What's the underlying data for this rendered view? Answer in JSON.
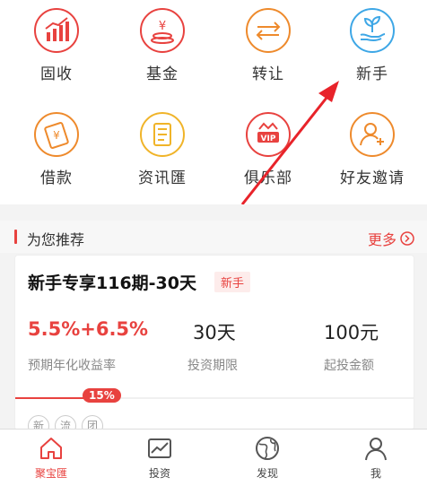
{
  "quick_menu": [
    {
      "label": "固收",
      "icon": "chart-growth-icon"
    },
    {
      "label": "基金",
      "icon": "fund-coin-icon"
    },
    {
      "label": "转让",
      "icon": "transfer-arrows-icon"
    },
    {
      "label": "新手",
      "icon": "plant-hand-icon"
    },
    {
      "label": "借款",
      "icon": "loan-card-icon"
    },
    {
      "label": "资讯匯",
      "icon": "news-icon"
    },
    {
      "label": "俱乐部",
      "icon": "vip-crown-icon"
    },
    {
      "label": "好友邀请",
      "icon": "invite-friend-icon"
    }
  ],
  "colors": {
    "accent": "#e8423f",
    "icon_red": "#e8423f",
    "icon_orange": "#ee8a2c",
    "icon_yellow": "#f0b429",
    "icon_blue": "#3ea7e6"
  },
  "recommend": {
    "title": "为您推荐",
    "more_label": "更多",
    "product": {
      "name": "新手专享116期-30天",
      "tag": "新手",
      "rate": "5.5%+6.5%",
      "rate_label": "预期年化收益率",
      "term": "30天",
      "term_label": "投资期限",
      "min_amount": "100元",
      "min_amount_label": "起投金额",
      "progress_percent": 15,
      "progress_label": "15%",
      "mini_tags": [
        "新",
        "流",
        "团"
      ]
    }
  },
  "tabbar": [
    {
      "label": "聚宝匯",
      "icon": "home-icon",
      "active": true
    },
    {
      "label": "投资",
      "icon": "invest-chart-icon",
      "active": false
    },
    {
      "label": "发现",
      "icon": "globe-icon",
      "active": false
    },
    {
      "label": "我",
      "icon": "profile-icon",
      "active": false
    }
  ]
}
